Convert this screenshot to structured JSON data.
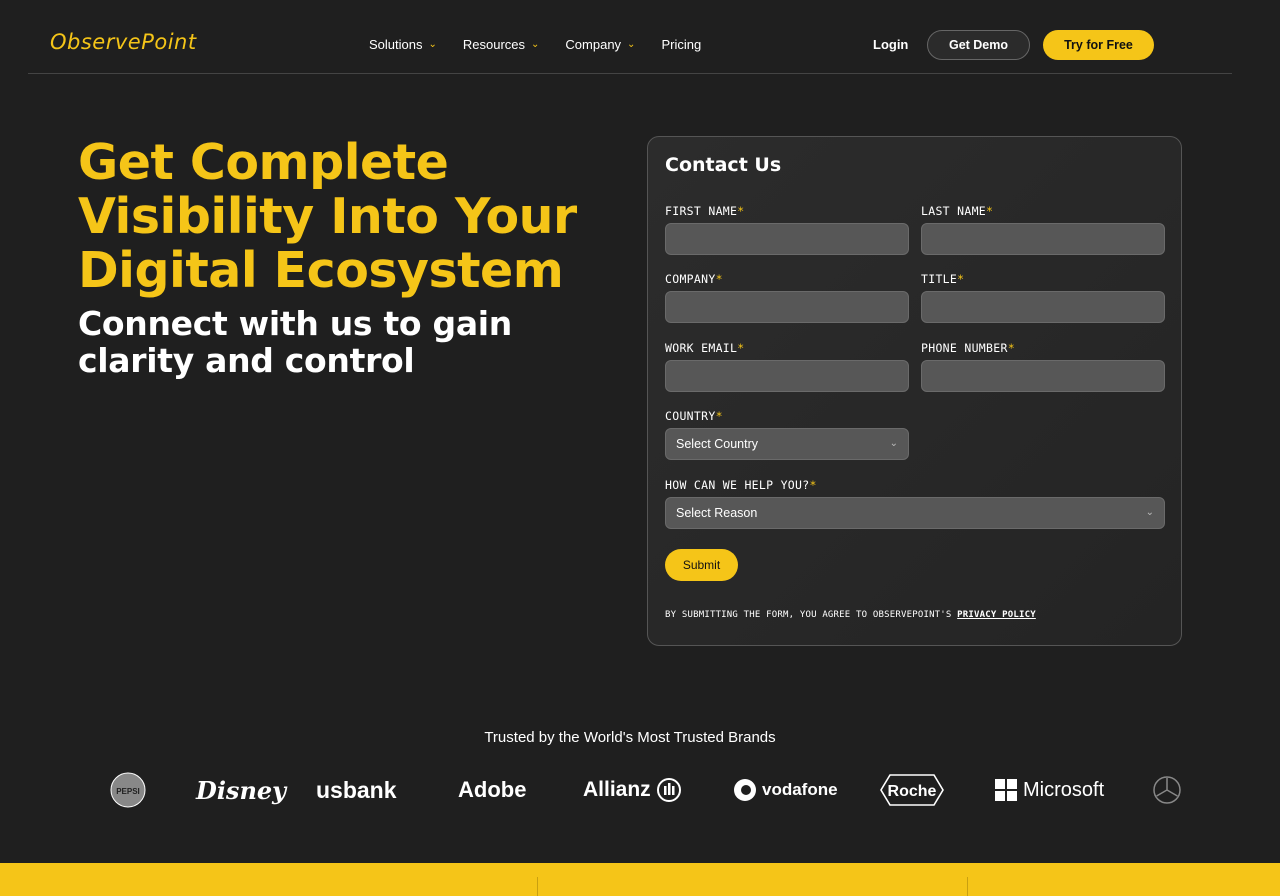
{
  "nav": {
    "logo": "ObservePoint",
    "menu": [
      {
        "label": "Solutions",
        "has_dropdown": true
      },
      {
        "label": "Resources",
        "has_dropdown": true
      },
      {
        "label": "Company",
        "has_dropdown": true
      },
      {
        "label": "Pricing",
        "has_dropdown": false
      }
    ],
    "login": "Login",
    "get_demo": "Get Demo",
    "try_free": "Try for Free"
  },
  "hero": {
    "title_lines": [
      "Get Complete",
      "Visibility Into Your",
      "Digital Ecosystem"
    ],
    "subtitle_lines": [
      "Connect with us to gain",
      "clarity and control"
    ]
  },
  "form": {
    "title": "Contact Us",
    "required_mark": "*",
    "fields": {
      "first_name": "FIRST NAME",
      "last_name": "LAST NAME",
      "company": "COMPANY",
      "title": "TITLE",
      "work_email": "WORK EMAIL",
      "phone": "PHONE NUMBER",
      "country": "COUNTRY",
      "help": "HOW CAN WE HELP YOU?"
    },
    "country_placeholder": "Select Country",
    "reason_placeholder": "Select Reason",
    "submit": "Submit",
    "legal_text": "BY SUBMITTING THE FORM, YOU AGREE TO OBSERVEPOINT'S",
    "privacy_link": "PRIVACY POLICY"
  },
  "trusted": {
    "heading": "Trusted by the World's Most Trusted Brands",
    "brands": [
      "PEPSI",
      "Disney",
      "usbank",
      "Adobe",
      "Allianz",
      "vodafone",
      "Roche",
      "Microsoft",
      "Mercedes-Benz"
    ]
  },
  "colors": {
    "accent": "#f5c518",
    "background": "#1f1f1f",
    "input": "#575757"
  }
}
